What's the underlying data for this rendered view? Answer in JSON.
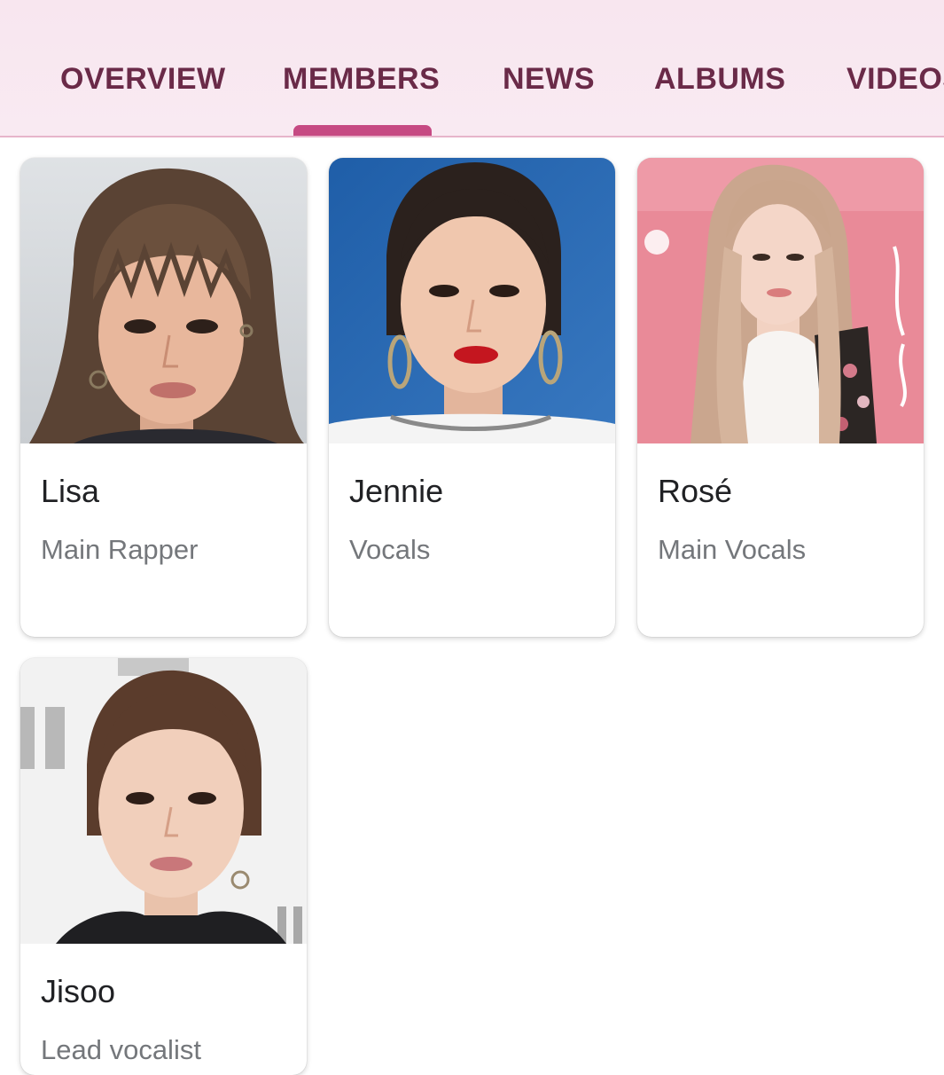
{
  "tabs": [
    {
      "label": "OVERVIEW"
    },
    {
      "label": "MEMBERS",
      "selected": true
    },
    {
      "label": "NEWS"
    },
    {
      "label": "ALBUMS"
    },
    {
      "label": "VIDEOS"
    }
  ],
  "colors": {
    "tab_text": "#6a2a48",
    "indicator": "#c64a83",
    "tabbar_bg": "#f8e6ef"
  },
  "members": [
    {
      "name": "Lisa",
      "role": "Main Rapper",
      "photo": "portrait-photo"
    },
    {
      "name": "Jennie",
      "role": "Vocals",
      "photo": "portrait-photo"
    },
    {
      "name": "Rosé",
      "role": "Main Vocals",
      "photo": "portrait-photo"
    },
    {
      "name": "Jisoo",
      "role": "Lead vocalist",
      "photo": "portrait-photo"
    }
  ]
}
